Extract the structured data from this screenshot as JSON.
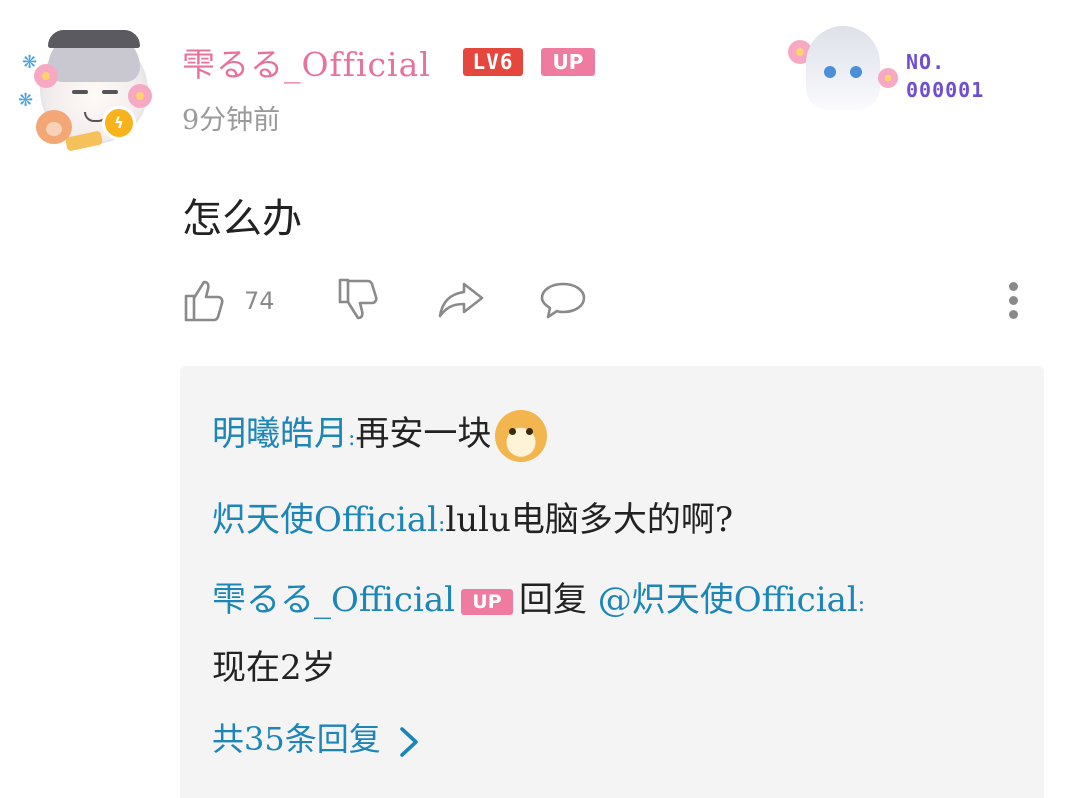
{
  "comment": {
    "user": {
      "name": "雫るる_Official",
      "level_badge": "LV6",
      "up_badge": "UP"
    },
    "time": "9分钟前",
    "text": "怎么办",
    "likes": "74",
    "fan_badge": {
      "no_label": "NO.",
      "number": "000001"
    }
  },
  "actions": {
    "like": "like",
    "dislike": "dislike",
    "share": "share",
    "reply": "reply",
    "more": "more"
  },
  "replies": [
    {
      "name": "明曦皓月",
      "separator": ":",
      "text": "再安一块",
      "emoji": "doge-emoji"
    },
    {
      "name": "炽天使Official",
      "separator": ":",
      "text": "lulu电脑多大的啊?"
    },
    {
      "name": "雫るる_Official",
      "up_badge": "UP",
      "reply_word": "回复",
      "mention": "@炽天使Official",
      "separator": ":",
      "text": "现在2岁"
    }
  ],
  "view_more": "共35条回复",
  "colors": {
    "username_pink": "#e8739a",
    "level_red": "#e5473f",
    "up_pink": "#f07ba0",
    "reply_blue": "#1c86b8",
    "fan_purple": "#6f4fd0",
    "reply_bg": "#f4f4f4"
  }
}
